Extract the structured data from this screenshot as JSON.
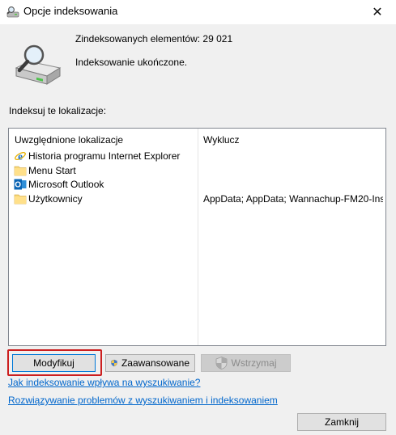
{
  "window": {
    "title": "Opcje indeksowania",
    "close_glyph": "✕"
  },
  "summary": {
    "count_label": "Zindeksowanych elementów: 29 021",
    "status": "Indeksowanie ukończone."
  },
  "locations_label": "Indeksuj te lokalizacje:",
  "list": {
    "columns": {
      "included": "Uwzględnione lokalizacje",
      "excluded": "Wyklucz"
    },
    "rows": [
      {
        "name": "Historia programu Internet Explorer",
        "icon": "internet-explorer-icon",
        "exclude": ""
      },
      {
        "name": "Menu Start",
        "icon": "folder-icon",
        "exclude": ""
      },
      {
        "name": "Microsoft Outlook",
        "icon": "outlook-icon",
        "exclude": ""
      },
      {
        "name": "Użytkownicy",
        "icon": "folder-icon",
        "exclude": "AppData; AppData; Wannachup-FM20-Ins..."
      }
    ]
  },
  "buttons": {
    "modify": "Modyfikuj",
    "advanced": "Zaawansowane",
    "pause": "Wstrzymaj",
    "close": "Zamknij"
  },
  "links": {
    "how_indexing_affects": "Jak indeksowanie wpływa na wyszukiwanie?",
    "troubleshoot": "Rozwiązywanie problemów z wyszukiwaniem i indeksowaniem"
  },
  "colors": {
    "link": "#0066cc",
    "highlight": "#cc1f1f",
    "focus_border": "#0078d7"
  }
}
